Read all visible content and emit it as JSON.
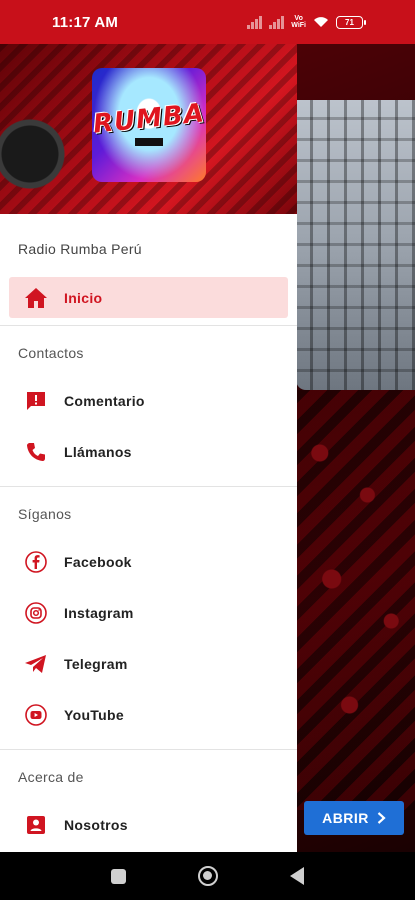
{
  "status_bar": {
    "time": "11:17 AM",
    "wifi_label": "Vo\nWiFi",
    "battery": "71"
  },
  "drawer": {
    "logo_text": "RUMBA",
    "title": "Radio Rumba Perú",
    "items_main": [
      {
        "label": "Inicio",
        "icon": "home-icon",
        "active": true
      }
    ],
    "sections": [
      {
        "title": "Contactos",
        "items": [
          {
            "label": "Comentario",
            "icon": "comment-alert-icon"
          },
          {
            "label": "Llámanos",
            "icon": "phone-icon"
          }
        ]
      },
      {
        "title": "Síganos",
        "items": [
          {
            "label": "Facebook",
            "icon": "facebook-icon"
          },
          {
            "label": "Instagram",
            "icon": "instagram-icon"
          },
          {
            "label": "Telegram",
            "icon": "telegram-icon"
          },
          {
            "label": "YouTube",
            "icon": "youtube-icon"
          }
        ]
      },
      {
        "title": "Acerca de",
        "items": [
          {
            "label": "Nosotros",
            "icon": "contact-card-icon"
          }
        ]
      }
    ]
  },
  "background": {
    "open_button_label": "ABRIR"
  },
  "colors": {
    "accent": "#d01521",
    "active_bg": "#fbdcdc",
    "status_bar": "#c8101a",
    "button_blue": "#1f6fd6"
  }
}
